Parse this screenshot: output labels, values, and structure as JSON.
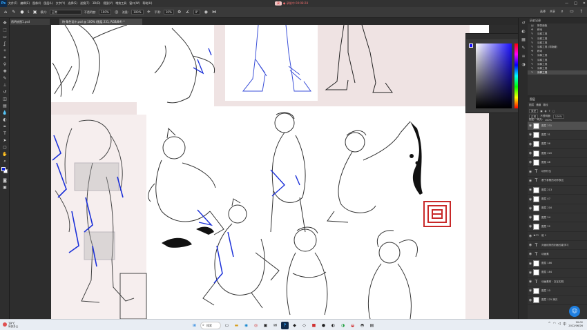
{
  "menu": {
    "items": [
      "文件(F)",
      "编辑(E)",
      "图像(I)",
      "图层(L)",
      "文字(Y)",
      "选择(S)",
      "滤镜(T)",
      "3D(D)",
      "视图(V)",
      "增效工具",
      "窗口(W)",
      "帮助(H)"
    ]
  },
  "recording": {
    "label": "录",
    "time": "● 录制中 00:08:28"
  },
  "options": {
    "brush_size": "5",
    "mode_label": "模式:",
    "mode_value": "正常",
    "opacity_label": "不透明度:",
    "opacity_value": "100%",
    "flow_label": "流量:",
    "flow_value": "100%",
    "smooth_label": "平滑:",
    "smooth_value": "10%",
    "angle_value": "0°",
    "right_a": "选择",
    "right_b": "共享"
  },
  "document": {
    "tab_small": "透明底图1.psd",
    "tab_title": "特·角色设计.psd @ 100% (图层 231, RGB/8#) *"
  },
  "picker": {
    "fg_color": "#1a10ff",
    "hex_label": ""
  },
  "history": {
    "title": "历史记录",
    "items": [
      {
        "icon": "doc",
        "label": "新的面板"
      },
      {
        "icon": "move",
        "label": "移动"
      },
      {
        "icon": "brush",
        "label": "涂鸦工具"
      },
      {
        "icon": "brush",
        "label": "涂鸦工具"
      },
      {
        "icon": "brush",
        "label": "涂鸦工具"
      },
      {
        "icon": "brush",
        "label": "涂鸦工具 (非隐藏)"
      },
      {
        "icon": "move",
        "label": "移动"
      },
      {
        "icon": "brush",
        "label": "涂鸦工具"
      },
      {
        "icon": "brush",
        "label": "涂鸦工具"
      },
      {
        "icon": "brush",
        "label": "涂鸦工具"
      },
      {
        "icon": "brush",
        "label": "涂鸦工具"
      },
      {
        "icon": "brush",
        "label": "涂鸦工具"
      }
    ]
  },
  "layers": {
    "title": "图层",
    "tabs": [
      "图层",
      "通道",
      "路径"
    ],
    "kind_label": "类型",
    "blend_mode": "正常",
    "opacity_label": "不透明度:",
    "opacity_value": "100%",
    "lock_label": "锁定:",
    "fill_label": "填充:",
    "fill_value": "100%",
    "rows": [
      {
        "type": "pixel",
        "name": "图层 231",
        "selected": true
      },
      {
        "type": "pixel",
        "name": "图层 31"
      },
      {
        "type": "pixel",
        "name": "图层 56"
      },
      {
        "type": "pixel",
        "name": "图层 220"
      },
      {
        "type": "pixel",
        "name": "图层 48"
      },
      {
        "type": "text",
        "name": "动作衍生"
      },
      {
        "type": "text",
        "name": "基于参照的动作表达"
      },
      {
        "type": "pixel",
        "name": "图层 213"
      },
      {
        "type": "pixel",
        "name": "图层 47"
      },
      {
        "type": "pixel",
        "name": "图层 216"
      },
      {
        "type": "pixel",
        "name": "图层 24"
      },
      {
        "type": "pixel",
        "name": "图层 22"
      },
      {
        "type": "folder",
        "name": "组 1"
      },
      {
        "type": "text",
        "name": "对画线条的刻画也能学习"
      },
      {
        "type": "text",
        "name": "动画素"
      },
      {
        "type": "pixel",
        "name": "图层 186"
      },
      {
        "type": "pixel",
        "name": "图层 184"
      },
      {
        "type": "text",
        "name": "动画素材 · 交互实践"
      },
      {
        "type": "pixel",
        "name": "图层 10"
      },
      {
        "type": "pixel",
        "name": "图层 125 拷贝"
      }
    ]
  },
  "taskbar": {
    "weather_temp": "19°C",
    "weather_desc": "局部多云",
    "search_label": "搜索",
    "time": "20:02",
    "date": "2022/06/26"
  }
}
